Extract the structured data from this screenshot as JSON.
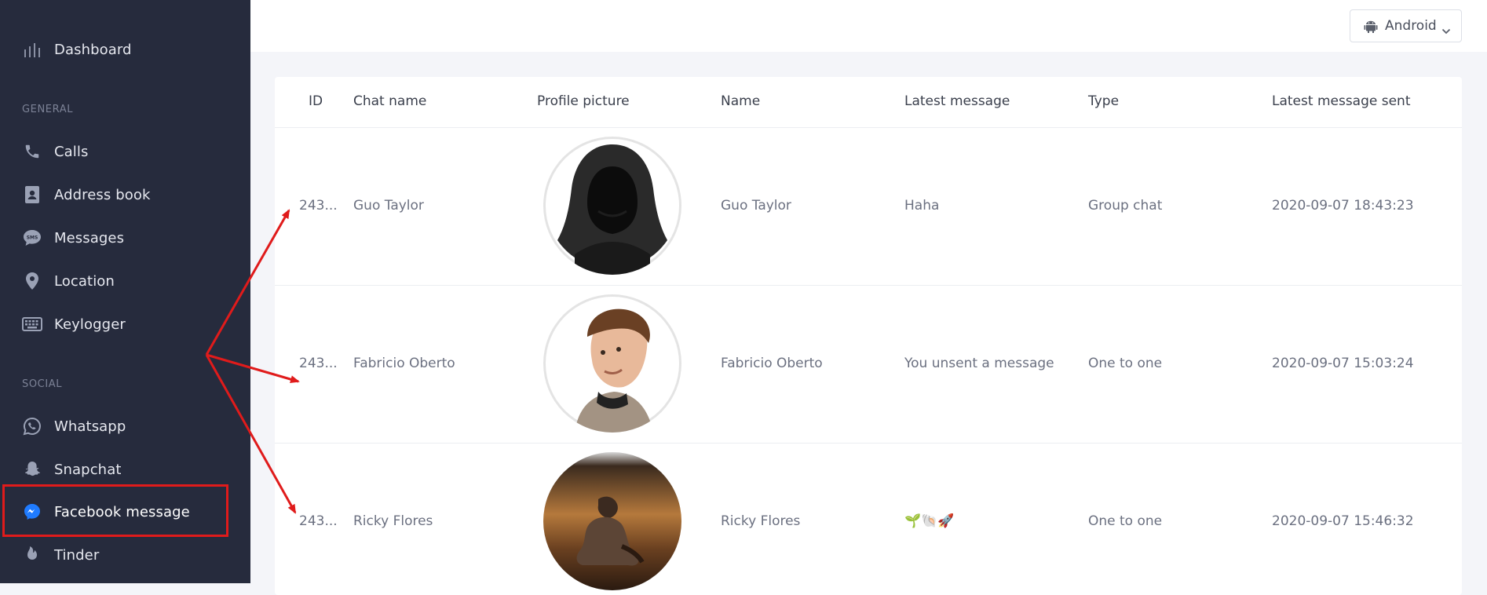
{
  "sidebar": {
    "dashboard": "Dashboard",
    "sections": {
      "general": "GENERAL",
      "social": "SOCIAL"
    },
    "general_items": [
      {
        "label": "Calls",
        "icon": "phone-icon"
      },
      {
        "label": "Address book",
        "icon": "address-book-icon"
      },
      {
        "label": "Messages",
        "icon": "sms-icon"
      },
      {
        "label": "Location",
        "icon": "location-pin-icon"
      },
      {
        "label": "Keylogger",
        "icon": "keyboard-icon"
      }
    ],
    "social_items": [
      {
        "label": "Whatsapp",
        "icon": "whatsapp-icon"
      },
      {
        "label": "Snapchat",
        "icon": "snapchat-icon"
      },
      {
        "label": "Facebook message",
        "icon": "messenger-icon",
        "active": true
      },
      {
        "label": "Tinder",
        "icon": "tinder-flame-icon"
      }
    ]
  },
  "topbar": {
    "platform": "Android",
    "platform_icon": "android-icon"
  },
  "table": {
    "columns": [
      "ID",
      "Chat name",
      "Profile picture",
      "Name",
      "Latest message",
      "Type",
      "Latest message sent"
    ],
    "rows": [
      {
        "id": "243...",
        "chat_name": "Guo Taylor",
        "name": "Guo Taylor",
        "latest_message": "Haha",
        "type": "Group chat",
        "sent": "2020-09-07 18:43:23"
      },
      {
        "id": "243...",
        "chat_name": "Fabricio Oberto",
        "name": "Fabricio Oberto",
        "latest_message": "You unsent a message",
        "type": "One to one",
        "sent": "2020-09-07 15:03:24"
      },
      {
        "id": "243...",
        "chat_name": "Ricky Flores",
        "name": "Ricky Flores",
        "latest_message": "🌱🐚🚀",
        "type": "One to one",
        "sent": "2020-09-07 15:46:32"
      }
    ]
  },
  "colors": {
    "sidebar_bg": "#262b3d",
    "annotation_red": "#e01b1b",
    "messenger_blue": "#1f7bff"
  }
}
